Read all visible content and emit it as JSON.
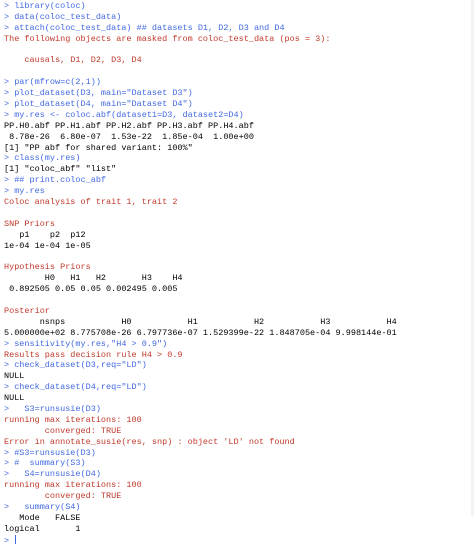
{
  "console": {
    "lines": [
      {
        "type": "input",
        "text": "> library(coloc)"
      },
      {
        "type": "input",
        "text": "> data(coloc_test_data)"
      },
      {
        "type": "input",
        "text": "> attach(coloc_test_data) ## datasets D1, D2, D3 and D4"
      },
      {
        "type": "message",
        "text": "The following objects are masked from coloc_test_data (pos = 3):"
      },
      {
        "type": "message",
        "text": ""
      },
      {
        "type": "message",
        "text": "    causals, D1, D2, D3, D4"
      },
      {
        "type": "output",
        "text": ""
      },
      {
        "type": "input",
        "text": "> par(mfrow=c(2,1))"
      },
      {
        "type": "input",
        "text": "> plot_dataset(D3, main=\"Dataset D3\")"
      },
      {
        "type": "input",
        "text": "> plot_dataset(D4, main=\"Dataset D4\")"
      },
      {
        "type": "input",
        "text": "> my.res <- coloc.abf(dataset1=D3, dataset2=D4)"
      },
      {
        "type": "output",
        "text": "PP.H0.abf PP.H1.abf PP.H2.abf PP.H3.abf PP.H4.abf"
      },
      {
        "type": "output",
        "text": " 8.78e-26  6.80e-07  1.53e-22  1.85e-04  1.00e+00"
      },
      {
        "type": "output",
        "text": "[1] \"PP abf for shared variant: 100%\""
      },
      {
        "type": "input",
        "text": "> class(my.res)"
      },
      {
        "type": "output",
        "text": "[1] \"coloc_abf\" \"list\""
      },
      {
        "type": "input",
        "text": "> ## print.coloc_abf"
      },
      {
        "type": "input",
        "text": "> my.res"
      },
      {
        "type": "message",
        "text": "Coloc analysis of trait 1, trait 2"
      },
      {
        "type": "output",
        "text": ""
      },
      {
        "type": "message",
        "text": "SNP Priors"
      },
      {
        "type": "output",
        "text": "   p1    p2  p12"
      },
      {
        "type": "output",
        "text": "1e-04 1e-04 1e-05"
      },
      {
        "type": "output",
        "text": ""
      },
      {
        "type": "message",
        "text": "Hypothesis Priors"
      },
      {
        "type": "output",
        "text": "        H0   H1   H2       H3    H4"
      },
      {
        "type": "output",
        "text": " 0.892505 0.05 0.05 0.002495 0.005"
      },
      {
        "type": "output",
        "text": ""
      },
      {
        "type": "message",
        "text": "Posterior"
      },
      {
        "type": "output",
        "text": "       nsnps           H0           H1           H2           H3           H4"
      },
      {
        "type": "output",
        "text": "5.000000e+02 8.775708e-26 6.797736e-07 1.529399e-22 1.848705e-04 9.998144e-01"
      },
      {
        "type": "input",
        "text": "> sensitivity(my.res,\"H4 > 0.9\")"
      },
      {
        "type": "message",
        "text": "Results pass decision rule H4 > 0.9"
      },
      {
        "type": "input",
        "text": "> check_dataset(D3,req=\"LD\")"
      },
      {
        "type": "output",
        "text": "NULL"
      },
      {
        "type": "input",
        "text": "> check_dataset(D4,req=\"LD\")"
      },
      {
        "type": "output",
        "text": "NULL"
      },
      {
        "type": "input",
        "text": ">   S3=runsusie(D3)"
      },
      {
        "type": "message",
        "text": "running max iterations: 100"
      },
      {
        "type": "message",
        "text": "        converged: TRUE"
      },
      {
        "type": "message",
        "text": "Error in annotate_susie(res, snp) : object 'LD' not found"
      },
      {
        "type": "input",
        "text": "> #S3=runsusie(D3)"
      },
      {
        "type": "input",
        "text": "> #  summary(S3)"
      },
      {
        "type": "input",
        "text": ">   S4=runsusie(D4)"
      },
      {
        "type": "message",
        "text": "running max iterations: 100"
      },
      {
        "type": "message",
        "text": "        converged: TRUE"
      },
      {
        "type": "input",
        "text": ">   summary(S4)"
      },
      {
        "type": "output",
        "text": "   Mode   FALSE"
      },
      {
        "type": "output",
        "text": "logical       1"
      }
    ],
    "prompt": ">"
  },
  "colors": {
    "input": "#4169e1",
    "output": "#000000",
    "message": "#c0392b",
    "background": "#ffffff"
  }
}
